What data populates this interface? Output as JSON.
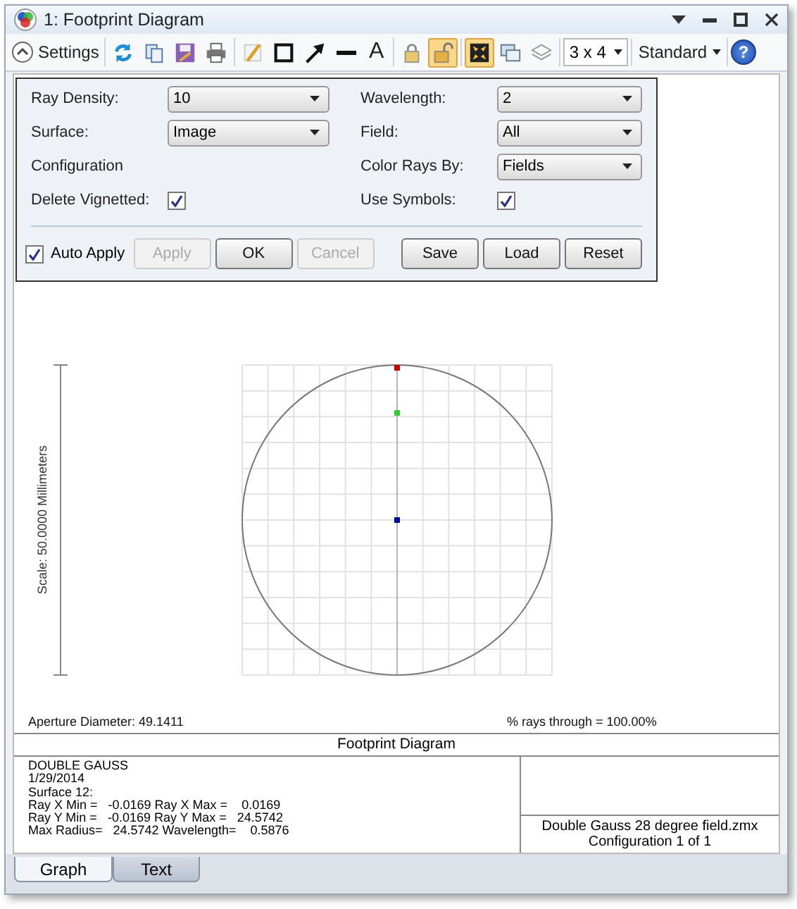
{
  "window": {
    "title": "1: Footprint Diagram"
  },
  "toolbar": {
    "settings": "Settings",
    "expanded": true,
    "tool_groups": [
      [
        {
          "kind": "refresh",
          "on": false
        },
        {
          "kind": "copy",
          "on": false
        },
        {
          "kind": "save",
          "on": false
        },
        {
          "kind": "print",
          "on": false
        }
      ],
      [
        {
          "kind": "pencil",
          "on": false
        },
        {
          "kind": "rect",
          "on": false
        },
        {
          "kind": "arrow",
          "on": false
        },
        {
          "kind": "line",
          "on": false
        },
        {
          "kind": "text",
          "label": "A",
          "on": false
        }
      ],
      [
        {
          "kind": "lock",
          "on": false
        },
        {
          "kind": "unlock",
          "on": true
        }
      ],
      [
        {
          "kind": "fit",
          "on": true
        },
        {
          "kind": "windows",
          "on": false
        },
        {
          "kind": "layers",
          "on": false
        }
      ]
    ],
    "layout": "3 x 4",
    "standard": "Standard",
    "help": "?"
  },
  "settings": {
    "left": [
      {
        "kind": "dropdown",
        "label": "Ray Density:",
        "value": "10"
      },
      {
        "kind": "dropdown",
        "label": "Surface:",
        "value": "Image"
      },
      {
        "kind": "label",
        "label": "Configuration"
      },
      {
        "kind": "checkbox",
        "label": "Delete Vignetted:",
        "checked": true
      }
    ],
    "right": [
      {
        "kind": "dropdown",
        "label": "Wavelength:",
        "value": "2"
      },
      {
        "kind": "dropdown",
        "label": "Field:",
        "value": "All"
      },
      {
        "kind": "dropdown",
        "label": "Color Rays By:",
        "value": "Fields"
      },
      {
        "kind": "checkbox",
        "label": "Use Symbols:",
        "checked": true
      }
    ],
    "auto_apply": {
      "label": "Auto Apply",
      "checked": true
    },
    "buttons": [
      {
        "label": "Apply",
        "disabled": true
      },
      {
        "label": "OK",
        "disabled": false
      },
      {
        "label": "Cancel",
        "disabled": true
      }
    ],
    "file_buttons": [
      {
        "label": "Save",
        "disabled": false
      },
      {
        "label": "Load",
        "disabled": false
      },
      {
        "label": "Reset",
        "disabled": false
      }
    ]
  },
  "plot": {
    "scale_label": "Scale: 50.0000 Millimeters",
    "markers": [
      {
        "color": "#cc0000"
      },
      {
        "color": "#33cc33"
      },
      {
        "color": "#000099"
      }
    ],
    "aperture": "Aperture Diameter: 49.1411",
    "rays_through": "% rays through = 100.00%"
  },
  "info": {
    "title": "Footprint Diagram",
    "lines": [
      "DOUBLE GAUSS",
      "1/29/2014",
      "Surface 12:",
      "Ray X Min =   -0.0169 Ray X Max =    0.0169",
      "Ray Y Min =   -0.0169 Ray Y Max =   24.5742",
      "Max Radius=   24.5742 Wavelength=    0.5876"
    ],
    "file_lines": [
      "Double Gauss 28 degree field.zmx",
      "Configuration 1 of 1"
    ]
  },
  "tabs": [
    {
      "label": "Graph",
      "selected": true
    },
    {
      "label": "Text",
      "selected": false
    }
  ]
}
